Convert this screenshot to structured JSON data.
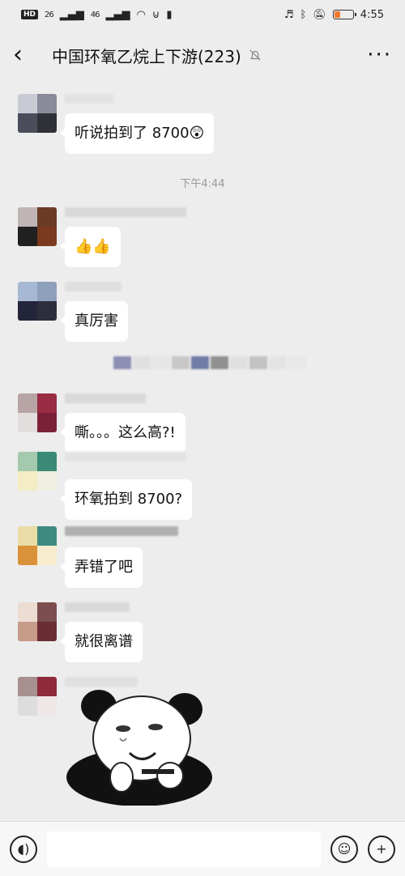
{
  "status": {
    "hd": "HD",
    "sig1": "26",
    "sig2": "46",
    "time": "4:55",
    "battery_level": 0.35
  },
  "header": {
    "title": "中国环氧乙烷上下游(223)",
    "more": "···"
  },
  "chat": {
    "time_separator": "下午4:44",
    "messages": [
      {
        "text": "听说拍到了 8700😲"
      },
      {
        "text": "👍👍"
      },
      {
        "text": "真厉害"
      },
      {
        "text": "嘶。。。这么高?!"
      },
      {
        "text": "环氧拍到 8700?"
      },
      {
        "text": "弄错了吧"
      },
      {
        "text": "就很离谱"
      }
    ]
  },
  "input": {
    "placeholder": ""
  },
  "colors": {
    "background": "#ededed",
    "bubble": "#ffffff",
    "accent_battery": "#f07a2f"
  }
}
